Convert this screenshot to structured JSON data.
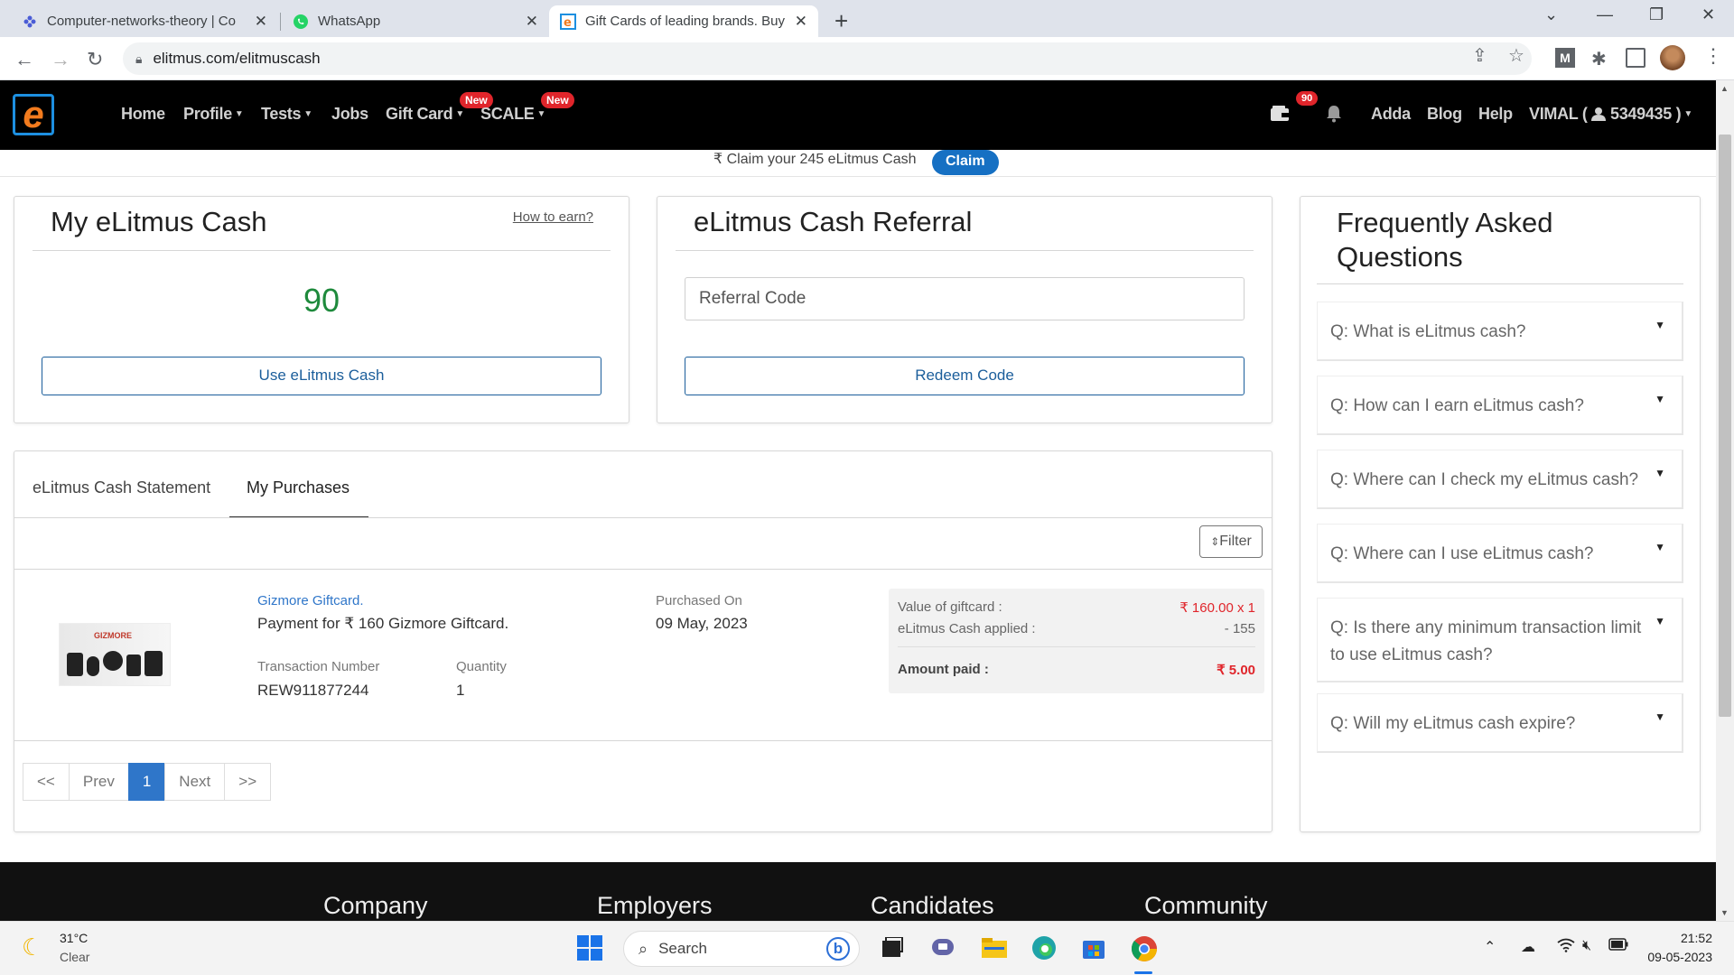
{
  "browser": {
    "tabs": [
      {
        "title": "Computer-networks-theory | Co",
        "icon": "slack-like-icon"
      },
      {
        "title": "WhatsApp",
        "icon": "whatsapp-icon"
      },
      {
        "title": "Gift Cards of leading brands. Buy",
        "icon": "elitmus-icon"
      }
    ],
    "url": "elitmus.com/elitmuscash"
  },
  "header": {
    "nav": [
      "Home",
      "Profile",
      "Tests",
      "Jobs",
      "Gift Card",
      "SCALE"
    ],
    "new_badge": "New",
    "notifications_count": "90",
    "right_links": [
      "Adda",
      "Blog",
      "Help"
    ],
    "user": "VIMAL (",
    "user_id": "5349435 )"
  },
  "claim": {
    "text": "₹ Claim your 245 eLitmus Cash",
    "button": "Claim"
  },
  "cash_card": {
    "title": "My eLitmus Cash",
    "how_to_earn": "How to earn?",
    "value": "90",
    "button": "Use eLitmus Cash"
  },
  "referral_card": {
    "title": "eLitmus Cash Referral",
    "placeholder": "Referral Code",
    "button": "Redeem Code"
  },
  "purchases": {
    "tabs": [
      "eLitmus Cash Statement",
      "My Purchases"
    ],
    "filter": "Filter",
    "item": {
      "brand_logo_text": "GIZMORE",
      "name": "Gizmore Giftcard.",
      "description": "Payment for ₹ 160 Gizmore Giftcard.",
      "txn_label": "Transaction Number",
      "txn_value": "REW911877244",
      "qty_label": "Quantity",
      "qty_value": "1",
      "purchased_label": "Purchased On",
      "purchased_value": "09 May, 2023",
      "value_label": "Value of giftcard :",
      "value_amount": "₹ 160.00 x 1",
      "applied_label": "eLitmus Cash applied :",
      "applied_amount": "- 155",
      "paid_label": "Amount paid :",
      "paid_amount": "₹ 5.00"
    },
    "pager": [
      "<<",
      "Prev",
      "1",
      "Next",
      ">>"
    ]
  },
  "faq": {
    "title": "Frequently Asked Questions",
    "items": [
      "Q: What is eLitmus cash?",
      "Q: How can I earn eLitmus cash?",
      "Q: Where can I check my eLitmus cash?",
      "Q: Where can I use eLitmus cash?",
      "Q: Is there any minimum transaction limit to use eLitmus cash?",
      "Q: Will my eLitmus cash expire?"
    ]
  },
  "footer": {
    "headings": [
      "Company",
      "Employers",
      "Candidates",
      "Community"
    ]
  },
  "taskbar": {
    "temp": "31°C",
    "weather": "Clear",
    "search": "Search",
    "time": "21:52",
    "date": "09-05-2023"
  },
  "colors": {
    "brand_blue": "#1670c3",
    "cash_green": "#1e8a3c",
    "badge_red": "#e0252b",
    "price_red": "#e0252b"
  }
}
